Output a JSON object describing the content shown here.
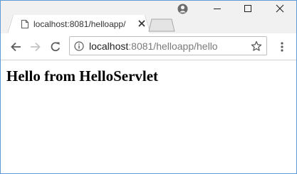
{
  "browser": {
    "tab": {
      "title": "localhost:8081/helloapp/"
    },
    "address_bar": {
      "host": "localhost",
      "path": ":8081/helloapp/hello"
    }
  },
  "page": {
    "heading": "Hello from HelloServlet"
  }
}
